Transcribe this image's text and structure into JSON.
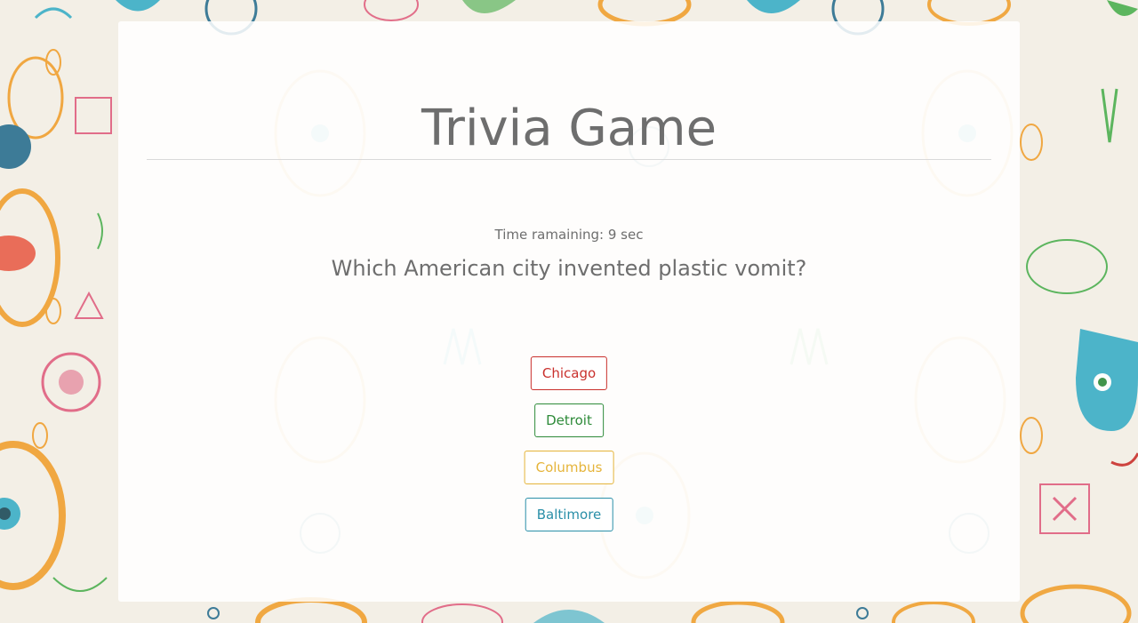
{
  "page": {
    "title": "Trivia Game",
    "timer_text": "Time ramaining: 9 sec",
    "question": "Which American city invented plastic vomit?"
  },
  "answers": [
    {
      "label": "Chicago",
      "color": "#c9302c"
    },
    {
      "label": "Detroit",
      "color": "#2e8b3a"
    },
    {
      "label": "Columbus",
      "color": "#e5b43a"
    },
    {
      "label": "Baltimore",
      "color": "#2a8fa8"
    }
  ],
  "theme": {
    "text_color": "#6e6e6e",
    "panel_color": "#ffffff"
  }
}
